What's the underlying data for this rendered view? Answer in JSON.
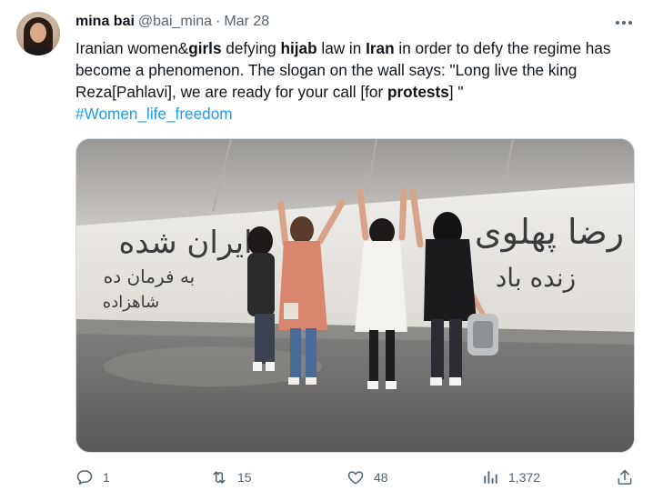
{
  "tweet": {
    "author_name": "mina bai",
    "handle": "@bai_mina",
    "separator": "·",
    "date": "Mar 28",
    "text_segments": [
      {
        "t": "Iranian women&",
        "b": false
      },
      {
        "t": "girls",
        "b": true
      },
      {
        "t": " defying ",
        "b": false
      },
      {
        "t": "hijab",
        "b": true
      },
      {
        "t": " law in ",
        "b": false
      },
      {
        "t": "Iran",
        "b": true
      },
      {
        "t": " in order to defy the regime has become a phenomenon. The slogan on the wall says: \"Long live the king Reza[Pahlavi], we are ready for your call [for ",
        "b": false
      },
      {
        "t": "protests",
        "b": true
      },
      {
        "t": "] \"",
        "b": false
      }
    ],
    "hashtag": "#Women_life_freedom",
    "wall_graffiti": {
      "left_line1": "ایران شده",
      "left_line2": "به فرمان ده",
      "left_line3": "شاهزاده",
      "right_line1": "رضا پهلوی",
      "right_line2": "زنده باد"
    }
  },
  "actions": {
    "reply_count": "1",
    "retweet_count": "15",
    "like_count": "48",
    "views_count": "1,372"
  },
  "colors": {
    "text_primary": "#0f1419",
    "text_secondary": "#536471",
    "link": "#1d9bf0"
  },
  "icons": [
    "more-icon",
    "reply-icon",
    "retweet-icon",
    "like-icon",
    "views-icon",
    "share-icon"
  ]
}
